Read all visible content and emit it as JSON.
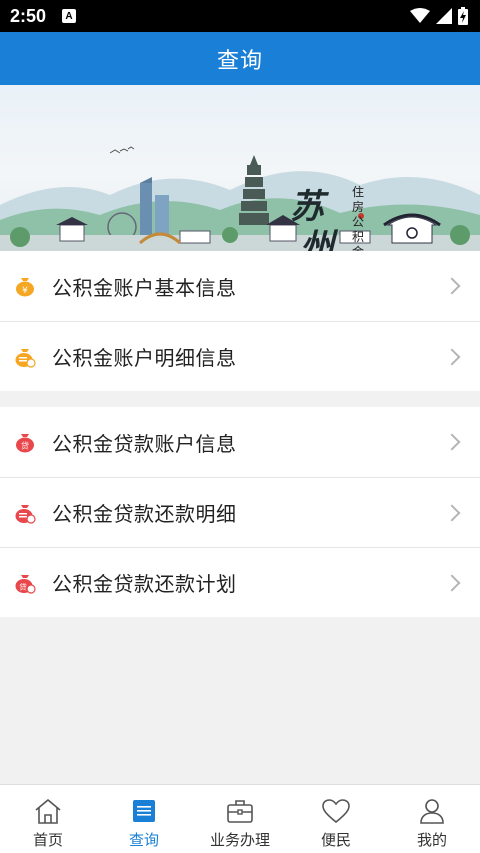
{
  "status_bar": {
    "time": "2:50",
    "notification_badge": "A"
  },
  "title_bar": {
    "title": "查询"
  },
  "banner": {
    "city": [
      "苏",
      "州"
    ],
    "subtitle": "住房公积金管理中心"
  },
  "groups": [
    {
      "items": [
        {
          "label": "公积金账户基本信息",
          "icon": "money-bag-yuan-icon",
          "color": "#f5a623"
        },
        {
          "label": "公积金账户明细信息",
          "icon": "money-bag-detail-icon",
          "color": "#f5a623"
        }
      ]
    },
    {
      "items": [
        {
          "label": "公积金贷款账户信息",
          "icon": "loan-bag-icon",
          "color": "#e8484b",
          "badge": "贷"
        },
        {
          "label": "公积金贷款还款明细",
          "icon": "loan-repay-detail-icon",
          "color": "#e8484b"
        },
        {
          "label": "公积金贷款还款计划",
          "icon": "loan-repay-plan-icon",
          "color": "#e8484b",
          "badge": "贷"
        }
      ]
    }
  ],
  "bottom_nav": [
    {
      "label": "首页",
      "icon": "home-icon",
      "active": false
    },
    {
      "label": "查询",
      "icon": "query-list-icon",
      "active": true
    },
    {
      "label": "业务办理",
      "icon": "briefcase-icon",
      "active": false
    },
    {
      "label": "便民",
      "icon": "heart-icon",
      "active": false
    },
    {
      "label": "我的",
      "icon": "user-icon",
      "active": false
    }
  ],
  "colors": {
    "primary": "#1a7fd6",
    "accent_orange": "#f5a623",
    "accent_red": "#e8484b"
  }
}
